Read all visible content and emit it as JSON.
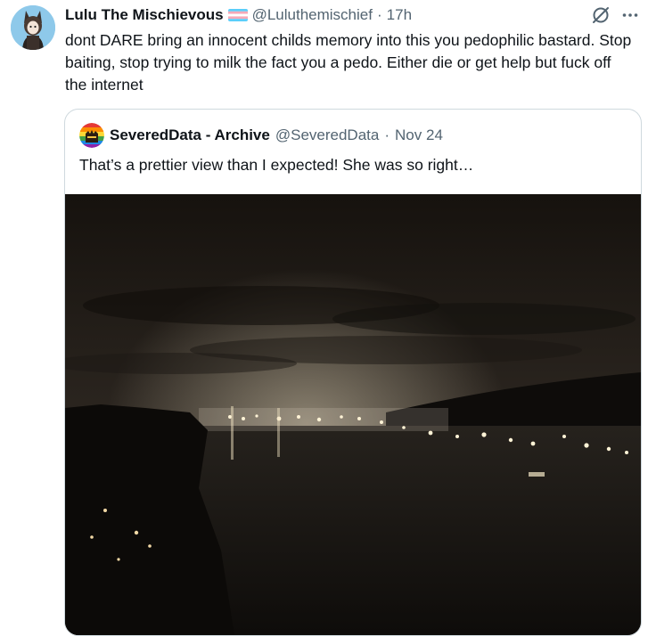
{
  "tweet": {
    "display_name": "Lulu The Mischievous",
    "handle": "@Luluthemischief",
    "separator": "·",
    "time": "17h",
    "text": "dont DARE bring an innocent childs memory into this you pedophilic bastard. Stop baiting, stop trying to milk the fact you a pedo. Either die or get help but fuck off the internet",
    "icons": {
      "avatar": "cartoon-avatar",
      "flag": "transgender-flag-icon",
      "grok": "grok-icon",
      "more": "more-icon"
    },
    "colors": {
      "avatar_bg": "#8ec9ea",
      "muted": "#536471",
      "text": "#0f1419",
      "border": "#cfd9de"
    }
  },
  "quote": {
    "display_name": "SeveredData - Archive",
    "handle": "@SeveredData",
    "separator": "·",
    "time": "Nov 24",
    "text": "That’s a prettier view than I expected! She was so right…",
    "icons": {
      "avatar": "rainbow-avatar",
      "photo": "night-harbor-photo"
    }
  }
}
